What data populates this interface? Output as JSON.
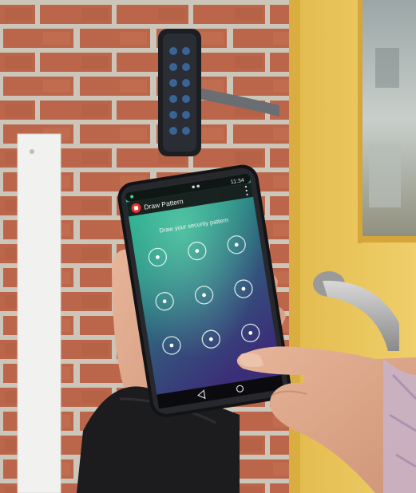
{
  "app": {
    "title": "Draw Pattern",
    "status_time": "11:34",
    "prompt": "Draw your security pattern"
  },
  "pattern_grid": {
    "rows": 3,
    "cols": 3,
    "nodes": [
      {
        "id": "node-1"
      },
      {
        "id": "node-2"
      },
      {
        "id": "node-3"
      },
      {
        "id": "node-4"
      },
      {
        "id": "node-5"
      },
      {
        "id": "node-6"
      },
      {
        "id": "node-7"
      },
      {
        "id": "node-8"
      },
      {
        "id": "node-9"
      }
    ]
  },
  "nav": {
    "back_icon": "triangle-back-icon",
    "home_icon": "circle-home-icon"
  },
  "colors": {
    "brick": "#b85a3c",
    "mortar": "#c9c1b5",
    "door": "#e8c45a",
    "screen_top": "#1fae8c",
    "screen_bottom": "#3a2f7a",
    "app_icon": "#e5322d",
    "keypad_led": "#3b6ea8"
  }
}
